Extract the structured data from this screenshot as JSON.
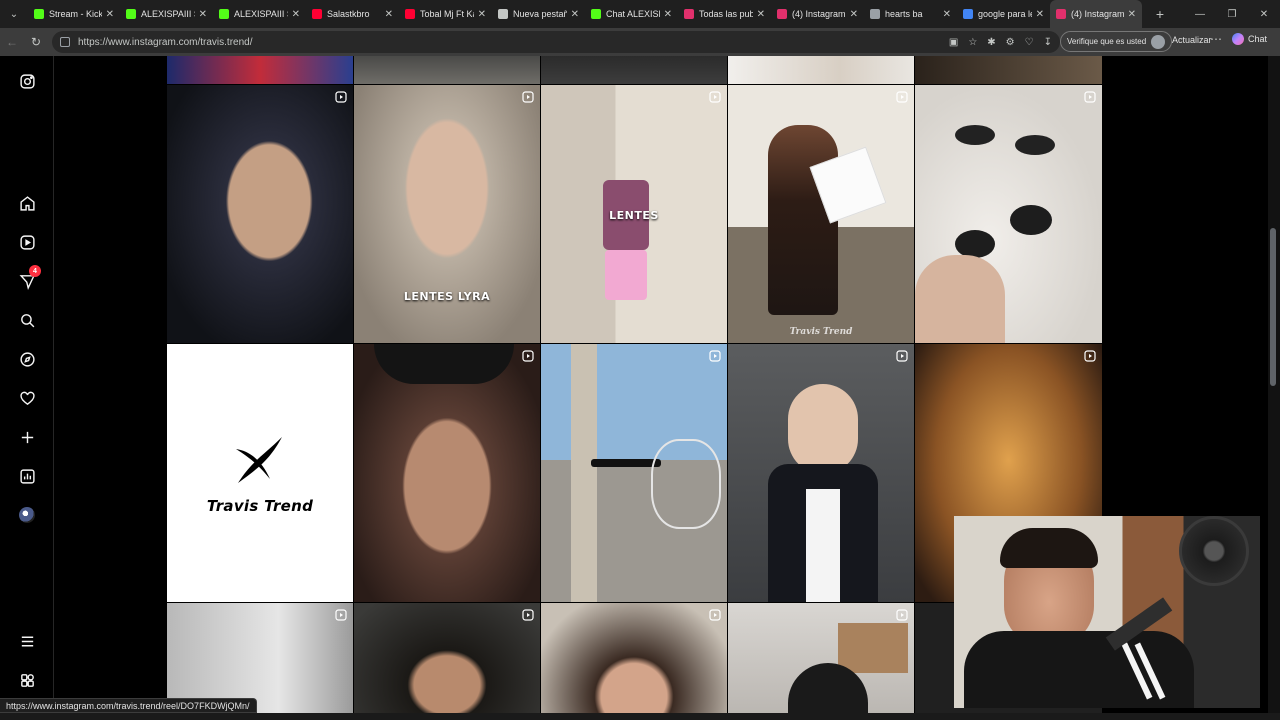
{
  "browser": {
    "tabs": [
      {
        "title": "Stream - Kick D",
        "icon": "kick-icon",
        "color": "#53fc18",
        "active": false
      },
      {
        "title": "ALEXISPAIII Stre",
        "icon": "kick-icon",
        "color": "#53fc18",
        "active": false
      },
      {
        "title": "ALEXISPAIII Stre",
        "icon": "kick-icon",
        "color": "#53fc18",
        "active": false
      },
      {
        "title": "Salastkbro",
        "icon": "youtube-icon",
        "color": "#ff0033",
        "active": false
      },
      {
        "title": "Tobal Mj Ft Kai",
        "icon": "youtube-icon",
        "color": "#ff0033",
        "active": false
      },
      {
        "title": "Nueva pestaña",
        "icon": "newtab-icon",
        "color": "#c4c7c5",
        "active": false
      },
      {
        "title": "Chat ALEXISPAI",
        "icon": "kick-icon",
        "color": "#53fc18",
        "active": false
      },
      {
        "title": "Todas las publi",
        "icon": "instagram-icon",
        "color": "#e1306c",
        "active": false
      },
      {
        "title": "(4) Instagram",
        "icon": "instagram-icon",
        "color": "#e1306c",
        "active": false
      },
      {
        "title": "hearts ba",
        "icon": "generic-icon",
        "color": "#9aa0a6",
        "active": false
      },
      {
        "title": "google para le",
        "icon": "google-icon",
        "color": "#4285f4",
        "active": false
      },
      {
        "title": "(4) Instagram",
        "icon": "instagram-icon",
        "color": "#e1306c",
        "active": true
      }
    ],
    "url": "https://www.instagram.com/travis.trend/",
    "verify_label": "Verifique que es usted",
    "update_label": "Actualizar",
    "chat_label": "Chat",
    "status_url": "https://www.instagram.com/travis.trend/reel/DO7FKDWjQMn/"
  },
  "sidebar": {
    "items": [
      {
        "name": "instagram-logo-icon"
      },
      {
        "name": "home-icon"
      },
      {
        "name": "reels-icon"
      },
      {
        "name": "messages-icon",
        "badge": "4"
      },
      {
        "name": "search-icon"
      },
      {
        "name": "explore-icon"
      },
      {
        "name": "notifications-icon"
      },
      {
        "name": "create-icon"
      },
      {
        "name": "dashboard-icon"
      },
      {
        "name": "profile-avatar"
      },
      {
        "name": "more-menu-icon"
      },
      {
        "name": "also-from-meta-icon"
      }
    ]
  },
  "grid": {
    "posts": [
      {
        "caption": "",
        "watermark": "",
        "reel": false
      },
      {
        "caption": "",
        "watermark": "",
        "reel": false
      },
      {
        "caption": "",
        "watermark": "",
        "reel": false
      },
      {
        "caption": "",
        "watermark": "",
        "reel": false
      },
      {
        "caption": "",
        "watermark": "",
        "reel": false
      },
      {
        "caption": "",
        "watermark": "",
        "reel": true
      },
      {
        "caption": "LENTES LYRA",
        "watermark": "",
        "reel": true
      },
      {
        "caption": "LENTES",
        "watermark": "",
        "reel": true
      },
      {
        "caption": "",
        "watermark": "Travis Trend",
        "reel": true
      },
      {
        "caption": "",
        "watermark": "",
        "reel": true
      },
      {
        "caption": "",
        "watermark": "",
        "reel": false,
        "logo": "Travis Trend"
      },
      {
        "caption": "",
        "watermark": "",
        "reel": true
      },
      {
        "caption": "",
        "watermark": "",
        "reel": true
      },
      {
        "caption": "",
        "watermark": "",
        "reel": true
      },
      {
        "caption": "",
        "watermark": "",
        "reel": true
      },
      {
        "caption": "",
        "watermark": "",
        "reel": true
      },
      {
        "caption": "",
        "watermark": "",
        "reel": true
      },
      {
        "caption": "",
        "watermark": "",
        "reel": true
      },
      {
        "caption": "",
        "watermark": "",
        "reel": true
      },
      {
        "caption": "",
        "watermark": "",
        "reel": false
      }
    ]
  }
}
